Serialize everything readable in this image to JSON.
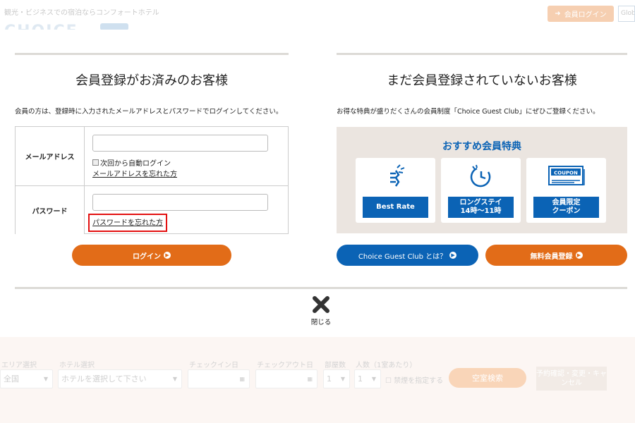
{
  "background": {
    "tagline": "観光・ビジネスでの宿泊ならコンフォートホテル",
    "logo": "CHOICE",
    "member_login_label": "会員ログイン",
    "lang_label": "Glob",
    "search": {
      "area_label": "エリア選択",
      "area_value": "全国",
      "hotel_label": "ホテル選択",
      "hotel_value": "ホテルを選択して下さい",
      "checkin_label": "チェックイン日",
      "checkout_label": "チェックアウト日",
      "rooms_label": "部屋数",
      "rooms_value": "1",
      "guests_label": "人数（1室あたり）",
      "guests_value": "1",
      "smoking_label": "禁煙を指定する",
      "search_button": "空室検索",
      "confirm_button": "予約確認・変更・キャンセル"
    }
  },
  "member": {
    "title": "会員登録がお済みのお客様",
    "description": "会員の方は、登録時に入力されたメールアドレスとパスワードでログインしてください。",
    "email_label": "メールアドレス",
    "email_value": "",
    "auto_login_label": "次回から自動ログイン",
    "forgot_email_link": "メールアドレスを忘れた方",
    "password_label": "パスワード",
    "password_value": "",
    "forgot_password_link": "パスワードを忘れた方",
    "login_button": "ログイン"
  },
  "nonmember": {
    "title": "まだ会員登録されていないお客様",
    "description": "お得な特典が盛りだくさんの会員制度「Choice Guest Club」にぜひご登録ください。",
    "benefits_title": "おすすめ会員特典",
    "benefits": [
      {
        "label": "Best Rate",
        "icon": "best-rate-icon"
      },
      {
        "label": "ロングステイ\n14時～11時",
        "icon": "clock-icon"
      },
      {
        "label": "会員限定\nクーポン",
        "icon": "coupon-icon"
      }
    ],
    "coupon_text": "COUPON",
    "about_button": "Choice Guest Club とは？",
    "register_button": "無料会員登録"
  },
  "close_label": "閉じる",
  "colors": {
    "orange": "#e26c18",
    "blue": "#0b63b5",
    "highlight_red": "#e31010",
    "panel_bg": "#ebe5e0"
  }
}
